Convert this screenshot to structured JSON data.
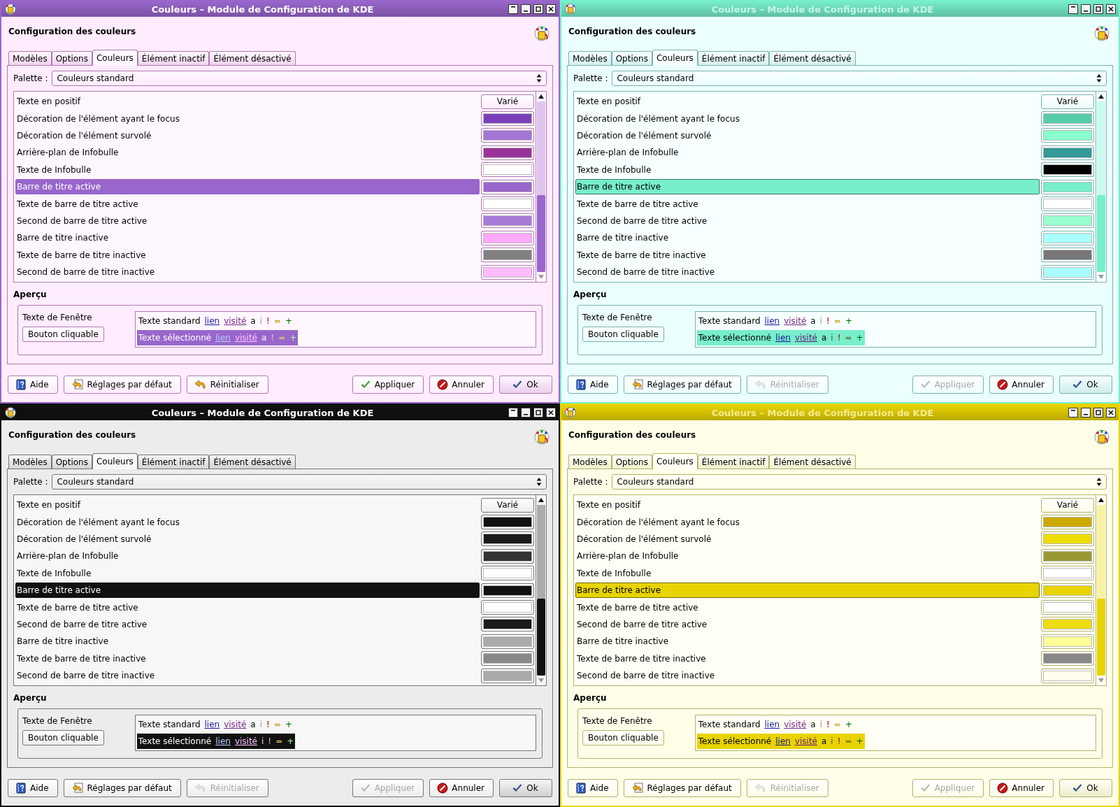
{
  "windows": [
    {
      "title": "Couleurs – Module de Configuration de KDE",
      "active": true,
      "heading": "Configuration des couleurs",
      "tabs": [
        {
          "label": "Modèles",
          "selected": false
        },
        {
          "label": "Options",
          "selected": false
        },
        {
          "label": "Couleurs",
          "selected": true
        },
        {
          "label": "Élément inactif",
          "selected": false
        },
        {
          "label": "Élément désactivé",
          "selected": false
        }
      ],
      "palette": {
        "label": "Palette :",
        "value": "Couleurs standard"
      },
      "rows": [
        {
          "label": "Texte en positif",
          "kind": "varied",
          "value": "Varié",
          "selected": false
        },
        {
          "label": "Décoration de l'élément ayant le focus",
          "kind": "swatch",
          "color": "#7a3fb8",
          "selected": false
        },
        {
          "label": "Décoration de l'élément survolé",
          "kind": "swatch",
          "color": "#a575d6",
          "selected": false
        },
        {
          "label": "Arrière-plan de Infobulle",
          "kind": "swatch",
          "color": "#993399",
          "selected": false
        },
        {
          "label": "Texte de Infobulle",
          "kind": "swatch",
          "color": "#ffffff",
          "selected": false
        },
        {
          "label": "Barre de titre active",
          "kind": "swatch",
          "color": "#9966cc",
          "selected": true
        },
        {
          "label": "Texte de barre de titre active",
          "kind": "swatch",
          "color": "#ffffff",
          "selected": false
        },
        {
          "label": "Second de barre de titre active",
          "kind": "swatch",
          "color": "#a77ad8",
          "selected": false
        },
        {
          "label": "Barre de titre inactive",
          "kind": "swatch",
          "color": "#ffaaff",
          "selected": false
        },
        {
          "label": "Texte de barre de titre inactive",
          "kind": "swatch",
          "color": "#808080",
          "selected": false
        },
        {
          "label": "Second de barre de titre inactive",
          "kind": "swatch",
          "color": "#ffbbff",
          "selected": false
        }
      ],
      "preview": {
        "heading": "Aperçu",
        "window_text": "Texte de Fenêtre",
        "button": "Bouton cliquable",
        "lines": [
          {
            "selected": false,
            "tokens": [
              {
                "text": "Texte standard",
                "kind": "plain"
              },
              {
                "text": "lien",
                "kind": "link"
              },
              {
                "text": "visité",
                "kind": "visited"
              },
              {
                "text": "a",
                "kind": "plain"
              },
              {
                "text": "i",
                "kind": "inactive"
              },
              {
                "text": "!",
                "kind": "negative"
              },
              {
                "text": "=",
                "kind": "neutral"
              },
              {
                "text": "+",
                "kind": "positive"
              }
            ]
          },
          {
            "selected": true,
            "tokens": [
              {
                "text": "Texte sélectionné",
                "kind": "plain"
              },
              {
                "text": "lien",
                "kind": "link"
              },
              {
                "text": "visité",
                "kind": "visited"
              },
              {
                "text": "a",
                "kind": "plain"
              },
              {
                "text": "!",
                "kind": "negative"
              },
              {
                "text": "=",
                "kind": "neutral"
              },
              {
                "text": "+",
                "kind": "positive"
              }
            ]
          }
        ]
      },
      "buttons": [
        {
          "label": "Aide",
          "kind": "help",
          "disabled": false
        },
        {
          "label": "Réglages par défaut",
          "kind": "defaults",
          "disabled": false
        },
        {
          "label": "Réinitialiser",
          "kind": "reset",
          "disabled": false
        },
        {
          "label": "Appliquer",
          "kind": "apply",
          "disabled": false
        },
        {
          "label": "Annuler",
          "kind": "cancel",
          "disabled": false
        },
        {
          "label": "Ok",
          "kind": "ok",
          "disabled": false
        }
      ]
    },
    {
      "title": "Couleurs – Module de Configuration de KDE",
      "active": false,
      "heading": "Configuration des couleurs",
      "tabs": [
        {
          "label": "Modèles",
          "selected": false
        },
        {
          "label": "Options",
          "selected": false
        },
        {
          "label": "Couleurs",
          "selected": true
        },
        {
          "label": "Élément inactif",
          "selected": false
        },
        {
          "label": "Élément désactivé",
          "selected": false
        }
      ],
      "palette": {
        "label": "Palette :",
        "value": "Couleurs standard"
      },
      "rows": [
        {
          "label": "Texte en positif",
          "kind": "varied",
          "value": "Varié",
          "selected": false
        },
        {
          "label": "Décoration de l'élément ayant le focus",
          "kind": "swatch",
          "color": "#55ccaa",
          "selected": false
        },
        {
          "label": "Décoration de l'élément survolé",
          "kind": "swatch",
          "color": "#88ffcc",
          "selected": false
        },
        {
          "label": "Arrière-plan de Infobulle",
          "kind": "swatch",
          "color": "#339999",
          "selected": false
        },
        {
          "label": "Texte de Infobulle",
          "kind": "swatch",
          "color": "#000000",
          "selected": false
        },
        {
          "label": "Barre de titre active",
          "kind": "swatch",
          "color": "#77eecc",
          "selected": true
        },
        {
          "label": "Texte de barre de titre active",
          "kind": "swatch",
          "color": "#ffffff",
          "selected": false
        },
        {
          "label": "Second de barre de titre active",
          "kind": "swatch",
          "color": "#99ffcc",
          "selected": false
        },
        {
          "label": "Barre de titre inactive",
          "kind": "swatch",
          "color": "#aaffff",
          "selected": false
        },
        {
          "label": "Texte de barre de titre inactive",
          "kind": "swatch",
          "color": "#777777",
          "selected": false
        },
        {
          "label": "Second de barre de titre inactive",
          "kind": "swatch",
          "color": "#aaffff",
          "selected": false
        }
      ],
      "preview": {
        "heading": "Aperçu",
        "window_text": "Texte de Fenêtre",
        "button": "Bouton cliquable",
        "lines": [
          {
            "selected": false,
            "tokens": [
              {
                "text": "Texte standard",
                "kind": "plain"
              },
              {
                "text": "lien",
                "kind": "link"
              },
              {
                "text": "visité",
                "kind": "visited"
              },
              {
                "text": "a",
                "kind": "plain"
              },
              {
                "text": "i",
                "kind": "inactive"
              },
              {
                "text": "!",
                "kind": "negative"
              },
              {
                "text": "=",
                "kind": "neutral"
              },
              {
                "text": "+",
                "kind": "positive"
              }
            ]
          },
          {
            "selected": true,
            "tokens": [
              {
                "text": "Texte sélectionné",
                "kind": "plain"
              },
              {
                "text": "lien",
                "kind": "link"
              },
              {
                "text": "visité",
                "kind": "visited"
              },
              {
                "text": "a",
                "kind": "plain"
              },
              {
                "text": "i",
                "kind": "inactive"
              },
              {
                "text": "!",
                "kind": "negative"
              },
              {
                "text": "=",
                "kind": "neutral"
              },
              {
                "text": "+",
                "kind": "positive"
              }
            ]
          }
        ]
      },
      "buttons": [
        {
          "label": "Aide",
          "kind": "help",
          "disabled": false
        },
        {
          "label": "Réglages par défaut",
          "kind": "defaults",
          "disabled": false
        },
        {
          "label": "Réinitialiser",
          "kind": "reset",
          "disabled": true
        },
        {
          "label": "Appliquer",
          "kind": "apply",
          "disabled": true
        },
        {
          "label": "Annuler",
          "kind": "cancel",
          "disabled": false
        },
        {
          "label": "Ok",
          "kind": "ok",
          "disabled": false
        }
      ]
    },
    {
      "title": "Couleurs – Module de Configuration de KDE",
      "active": true,
      "heading": "Configuration des couleurs",
      "tabs": [
        {
          "label": "Modèles",
          "selected": false
        },
        {
          "label": "Options",
          "selected": false
        },
        {
          "label": "Couleurs",
          "selected": true
        },
        {
          "label": "Élément inactif",
          "selected": false
        },
        {
          "label": "Élément désactivé",
          "selected": false
        }
      ],
      "palette": {
        "label": "Palette :",
        "value": "Couleurs standard"
      },
      "rows": [
        {
          "label": "Texte en positif",
          "kind": "varied",
          "value": "Varié",
          "selected": false
        },
        {
          "label": "Décoration de l'élément ayant le focus",
          "kind": "swatch",
          "color": "#111111",
          "selected": false
        },
        {
          "label": "Décoration de l'élément survolé",
          "kind": "swatch",
          "color": "#1a1a1a",
          "selected": false
        },
        {
          "label": "Arrière-plan de Infobulle",
          "kind": "swatch",
          "color": "#333333",
          "selected": false
        },
        {
          "label": "Texte de Infobulle",
          "kind": "swatch",
          "color": "#ffffff",
          "selected": false
        },
        {
          "label": "Barre de titre active",
          "kind": "swatch",
          "color": "#111111",
          "selected": true
        },
        {
          "label": "Texte de barre de titre active",
          "kind": "swatch",
          "color": "#ffffff",
          "selected": false
        },
        {
          "label": "Second de barre de titre active",
          "kind": "swatch",
          "color": "#1a1a1a",
          "selected": false
        },
        {
          "label": "Barre de titre inactive",
          "kind": "swatch",
          "color": "#aaaaaa",
          "selected": false
        },
        {
          "label": "Texte de barre de titre inactive",
          "kind": "swatch",
          "color": "#888888",
          "selected": false
        },
        {
          "label": "Second de barre de titre inactive",
          "kind": "swatch",
          "color": "#aaaaaa",
          "selected": false
        }
      ],
      "preview": {
        "heading": "Aperçu",
        "window_text": "Texte de Fenêtre",
        "button": "Bouton cliquable",
        "lines": [
          {
            "selected": false,
            "tokens": [
              {
                "text": "Texte standard",
                "kind": "plain"
              },
              {
                "text": "lien",
                "kind": "link"
              },
              {
                "text": "visité",
                "kind": "visited"
              },
              {
                "text": "a",
                "kind": "plain"
              },
              {
                "text": "i",
                "kind": "inactive"
              },
              {
                "text": "!",
                "kind": "negative"
              },
              {
                "text": "=",
                "kind": "neutral"
              },
              {
                "text": "+",
                "kind": "positive"
              }
            ]
          },
          {
            "selected": true,
            "tokens": [
              {
                "text": "Texte sélectionné",
                "kind": "plain"
              },
              {
                "text": "lien",
                "kind": "link"
              },
              {
                "text": "visité",
                "kind": "visited"
              },
              {
                "text": "i",
                "kind": "inactive"
              },
              {
                "text": "!",
                "kind": "negative"
              },
              {
                "text": "=",
                "kind": "neutral"
              },
              {
                "text": "+",
                "kind": "positive"
              }
            ]
          }
        ]
      },
      "buttons": [
        {
          "label": "Aide",
          "kind": "help",
          "disabled": false
        },
        {
          "label": "Réglages par défaut",
          "kind": "defaults",
          "disabled": false
        },
        {
          "label": "Réinitialiser",
          "kind": "reset",
          "disabled": true
        },
        {
          "label": "Appliquer",
          "kind": "apply",
          "disabled": true
        },
        {
          "label": "Annuler",
          "kind": "cancel",
          "disabled": false
        },
        {
          "label": "Ok",
          "kind": "ok",
          "disabled": false
        }
      ]
    },
    {
      "title": "Couleurs – Module de Configuration de KDE",
      "active": false,
      "heading": "Configuration des couleurs",
      "tabs": [
        {
          "label": "Modèles",
          "selected": false
        },
        {
          "label": "Options",
          "selected": false
        },
        {
          "label": "Couleurs",
          "selected": true
        },
        {
          "label": "Élément inactif",
          "selected": false
        },
        {
          "label": "Élément désactivé",
          "selected": false
        }
      ],
      "palette": {
        "label": "Palette :",
        "value": "Couleurs standard"
      },
      "rows": [
        {
          "label": "Texte en positif",
          "kind": "varied",
          "value": "Varié",
          "selected": false
        },
        {
          "label": "Décoration de l'élément ayant le focus",
          "kind": "swatch",
          "color": "#ccaa00",
          "selected": false
        },
        {
          "label": "Décoration de l'élément survolé",
          "kind": "swatch",
          "color": "#eedd00",
          "selected": false
        },
        {
          "label": "Arrière-plan de Infobulle",
          "kind": "swatch",
          "color": "#999933",
          "selected": false
        },
        {
          "label": "Texte de Infobulle",
          "kind": "swatch",
          "color": "#ffffff",
          "selected": false
        },
        {
          "label": "Barre de titre active",
          "kind": "swatch",
          "color": "#e8d400",
          "selected": true
        },
        {
          "label": "Texte de barre de titre active",
          "kind": "swatch",
          "color": "#ffffff",
          "selected": false
        },
        {
          "label": "Second de barre de titre active",
          "kind": "swatch",
          "color": "#eedd11",
          "selected": false
        },
        {
          "label": "Barre de titre inactive",
          "kind": "swatch",
          "color": "#ffff99",
          "selected": false
        },
        {
          "label": "Texte de barre de titre inactive",
          "kind": "swatch",
          "color": "#888888",
          "selected": false
        },
        {
          "label": "Second de barre de titre inactive",
          "kind": "swatch",
          "color": "#ffffee",
          "selected": false
        }
      ],
      "preview": {
        "heading": "Aperçu",
        "window_text": "Texte de Fenêtre",
        "button": "Bouton cliquable",
        "lines": [
          {
            "selected": false,
            "tokens": [
              {
                "text": "Texte standard",
                "kind": "plain"
              },
              {
                "text": "lien",
                "kind": "link"
              },
              {
                "text": "visité",
                "kind": "visited"
              },
              {
                "text": "a",
                "kind": "plain"
              },
              {
                "text": "i",
                "kind": "inactive"
              },
              {
                "text": "!",
                "kind": "negative"
              },
              {
                "text": "=",
                "kind": "neutral"
              },
              {
                "text": "+",
                "kind": "positive"
              }
            ]
          },
          {
            "selected": true,
            "tokens": [
              {
                "text": "Texte sélectionné",
                "kind": "plain"
              },
              {
                "text": "lien",
                "kind": "link"
              },
              {
                "text": "visité",
                "kind": "visited"
              },
              {
                "text": "a",
                "kind": "plain"
              },
              {
                "text": "i",
                "kind": "inactive"
              },
              {
                "text": "!",
                "kind": "negative"
              },
              {
                "text": "=",
                "kind": "neutral"
              },
              {
                "text": "+",
                "kind": "positive"
              }
            ]
          }
        ]
      },
      "buttons": [
        {
          "label": "Aide",
          "kind": "help",
          "disabled": false
        },
        {
          "label": "Réglages par défaut",
          "kind": "defaults",
          "disabled": false
        },
        {
          "label": "Réinitialiser",
          "kind": "reset",
          "disabled": true
        },
        {
          "label": "Appliquer",
          "kind": "apply",
          "disabled": true
        },
        {
          "label": "Annuler",
          "kind": "cancel",
          "disabled": false
        },
        {
          "label": "Ok",
          "kind": "ok",
          "disabled": false
        }
      ]
    }
  ]
}
